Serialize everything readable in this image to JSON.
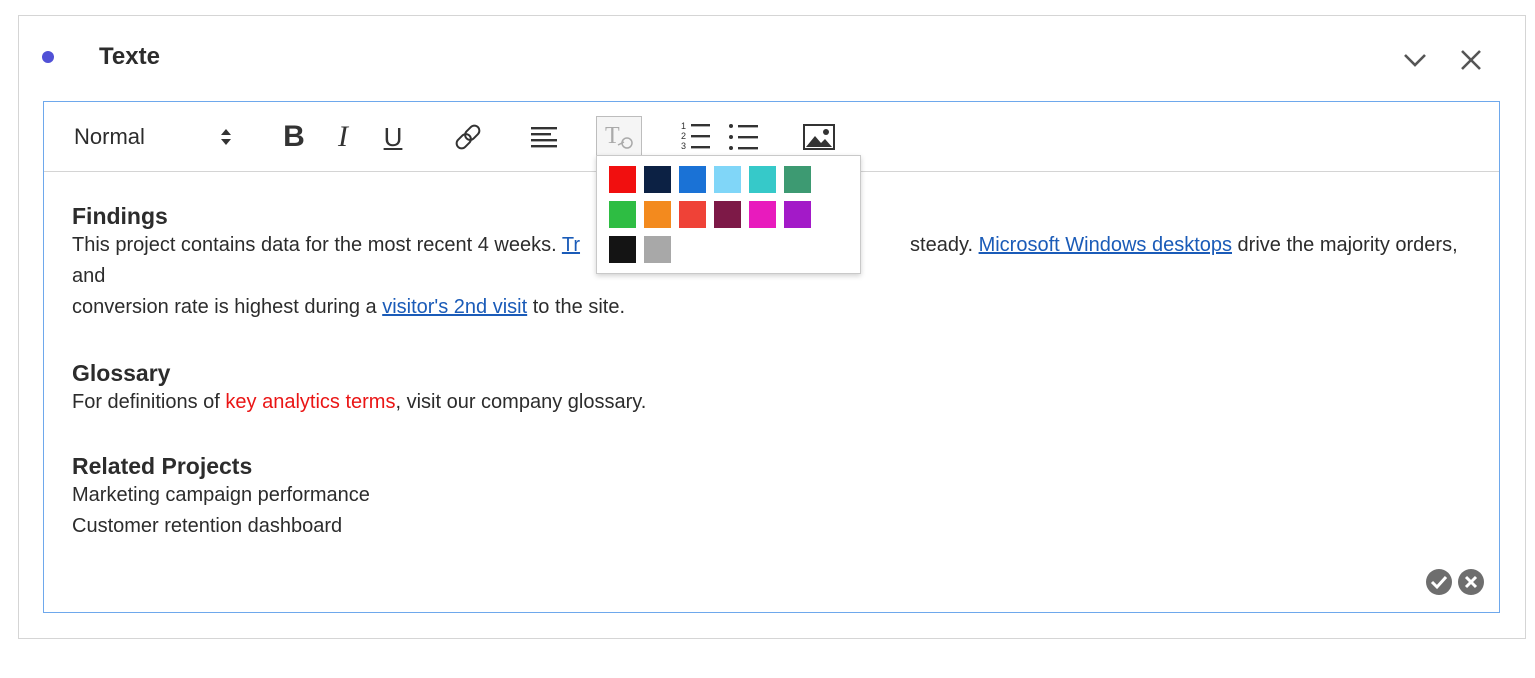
{
  "panel": {
    "title": "Texte",
    "dot_color": "#5151d6"
  },
  "header_icons": {
    "collapse": "chevron-down-icon",
    "close": "close-icon"
  },
  "toolbar": {
    "format_label": "Normal",
    "bold_label": "B",
    "italic_label": "I",
    "underline_label": "U",
    "icons": [
      "link-icon",
      "align-left-icon",
      "text-color-icon",
      "ordered-list-icon",
      "unordered-list-icon",
      "image-icon"
    ]
  },
  "palette": {
    "colors": [
      "#f10f0f",
      "#0c2144",
      "#1a72d6",
      "#80d6f8",
      "#36c9c9",
      "#3d9a72",
      "#2ebd43",
      "#f38a1e",
      "#ef4237",
      "#7d1947",
      "#e81bbd",
      "#a31ac8",
      "#141414",
      "#a8a8a8"
    ]
  },
  "content": {
    "findings": {
      "heading": "Findings",
      "line1_pre": "This project contains data for the most recent 4 weeks. ",
      "line1_link1": "Tr",
      "line1_mid": "steady. ",
      "line1_link2": "Microsoft Windows desktops",
      "line1_post": " drive the majority orders, and",
      "line2_pre": "conversion rate is highest during a ",
      "line2_link": "visitor's 2nd visit",
      "line2_post": " to the site."
    },
    "glossary": {
      "heading": "Glossary",
      "pre": "For definitions of ",
      "highlight": "key analytics terms",
      "post": ", visit our company glossary."
    },
    "related": {
      "heading": "Related Projects",
      "items": [
        "Marketing campaign performance",
        "Customer retention dashboard"
      ]
    }
  },
  "actions": {
    "confirm": "checkmark-circle-icon",
    "cancel": "cancel-circle-icon"
  },
  "colors": {
    "link": "#1a5bb8",
    "highlight": "#ea1515",
    "editor_border": "#6ea8ec"
  }
}
